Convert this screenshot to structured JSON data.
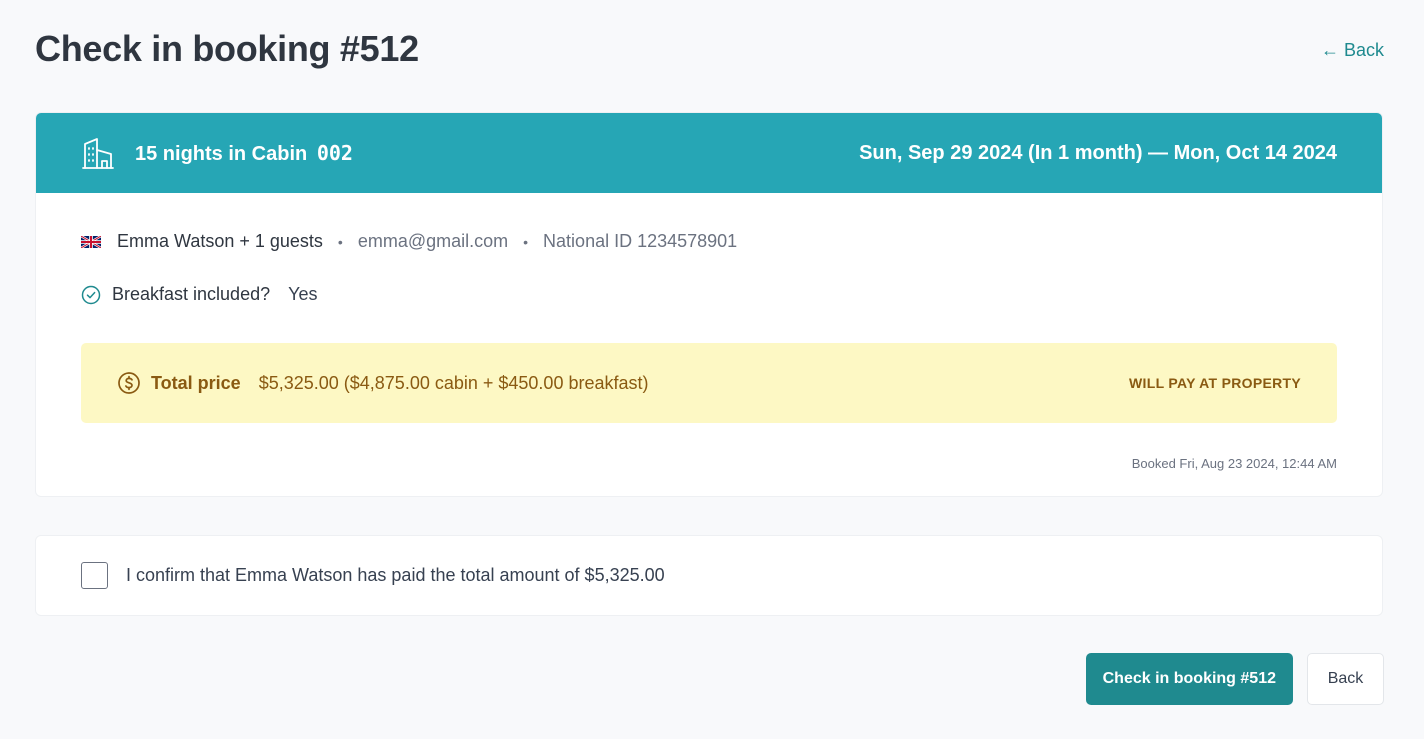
{
  "header": {
    "title": "Check in booking #512",
    "back_link": "← Back"
  },
  "booking": {
    "banner": {
      "icon": "cabin-icon",
      "title": "15 nights in Cabin",
      "cabin_code": "002",
      "dates": "Sun, Sep 29 2024 (In 1 month) — Mon, Oct 14 2024",
      "color": "#26a6b5"
    },
    "guest": {
      "flag_icon": "uk-flag-icon",
      "name": "Emma Watson + 1 guests",
      "email": "emma@gmail.com",
      "national_id": "National ID 1234578901",
      "separator": "•"
    },
    "breakfast": {
      "icon": "check-circle-icon",
      "label": "Breakfast included?",
      "value": "Yes"
    },
    "price": {
      "icon": "dollar-circle-icon",
      "label": "Total price",
      "value": "$5,325.00 ($4,875.00 cabin + $450.00 breakfast)",
      "status": "WILL PAY AT PROPERTY",
      "background": "#fdf8c4",
      "text_color": "#8a5a12"
    },
    "booked_at": "Booked Fri, Aug 23 2024, 12:44 AM"
  },
  "confirm": {
    "checked": false,
    "label": "I confirm that Emma Watson has paid the total amount of $5,325.00"
  },
  "actions": {
    "primary_label": "Check in booking #512",
    "secondary_label": "Back",
    "primary_color": "#1f8a8f"
  }
}
